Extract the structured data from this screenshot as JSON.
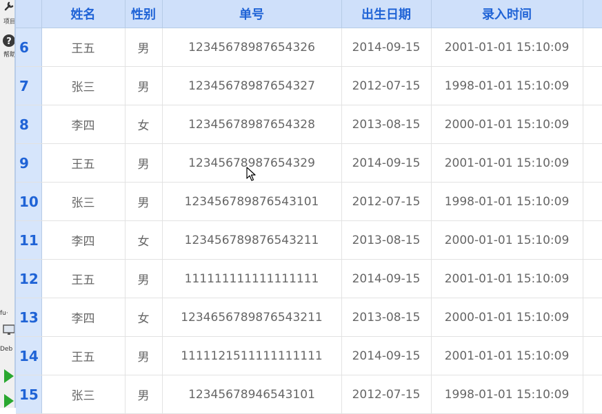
{
  "left_panel": {
    "item1_label": "项目",
    "item2_label": "帮助",
    "item3_label": "fu·",
    "item4_label": "Deb",
    "icons": [
      "wrench-icon",
      "help-icon",
      "monitor-icon",
      "run-icon",
      "run-icon"
    ]
  },
  "colors": {
    "header_bg": "#cfe0fa",
    "header_text": "#1f63d6",
    "index_bg": "#d6e5fb",
    "cell_text": "#666666",
    "run_green": "#2aa830"
  },
  "table": {
    "columns": [
      "姓名",
      "性别",
      "单号",
      "出生日期",
      "录入时间"
    ],
    "rows": [
      {
        "index": "6",
        "name": "王五",
        "gender": "男",
        "order_no": "12345678987654326",
        "birth_date": "2014-09-15",
        "entry_time": "2001-01-01 15:10:09"
      },
      {
        "index": "7",
        "name": "张三",
        "gender": "男",
        "order_no": "12345678987654327",
        "birth_date": "2012-07-15",
        "entry_time": "1998-01-01 15:10:09"
      },
      {
        "index": "8",
        "name": "李四",
        "gender": "女",
        "order_no": "12345678987654328",
        "birth_date": "2013-08-15",
        "entry_time": "2000-01-01 15:10:09"
      },
      {
        "index": "9",
        "name": "王五",
        "gender": "男",
        "order_no": "12345678987654329",
        "birth_date": "2014-09-15",
        "entry_time": "2001-01-01 15:10:09"
      },
      {
        "index": "10",
        "name": "张三",
        "gender": "男",
        "order_no": "123456789876543101",
        "birth_date": "2012-07-15",
        "entry_time": "1998-01-01 15:10:09"
      },
      {
        "index": "11",
        "name": "李四",
        "gender": "女",
        "order_no": "123456789876543211",
        "birth_date": "2013-08-15",
        "entry_time": "2000-01-01 15:10:09"
      },
      {
        "index": "12",
        "name": "王五",
        "gender": "男",
        "order_no": "111111111111111111",
        "birth_date": "2014-09-15",
        "entry_time": "2001-01-01 15:10:09"
      },
      {
        "index": "13",
        "name": "李四",
        "gender": "女",
        "order_no": "1234656789876543211",
        "birth_date": "2013-08-15",
        "entry_time": "2000-01-01 15:10:09"
      },
      {
        "index": "14",
        "name": "王五",
        "gender": "男",
        "order_no": "1111121511111111111",
        "birth_date": "2014-09-15",
        "entry_time": "2001-01-01 15:10:09"
      },
      {
        "index": "15",
        "name": "张三",
        "gender": "男",
        "order_no": "12345678946543101",
        "birth_date": "2012-07-15",
        "entry_time": "1998-01-01 15:10:09"
      }
    ]
  }
}
